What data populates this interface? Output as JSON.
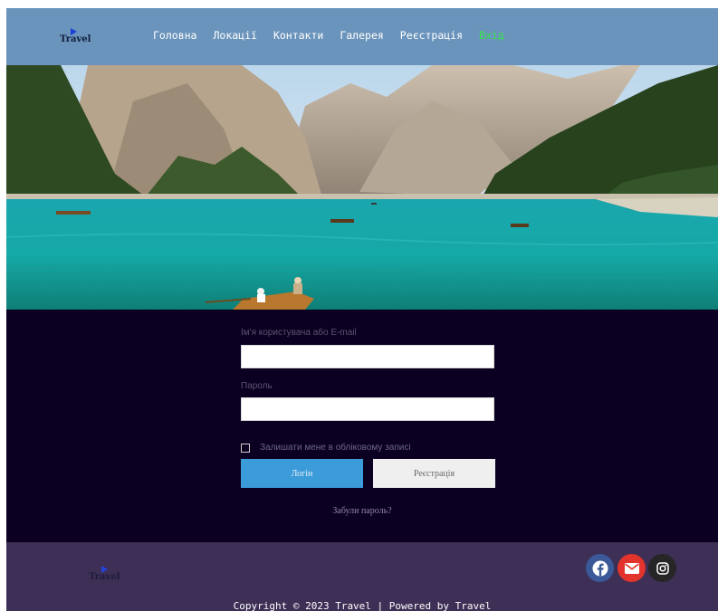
{
  "brand": {
    "logo_text": "Travel"
  },
  "nav": {
    "items": [
      {
        "label": "Головна"
      },
      {
        "label": "Локації"
      },
      {
        "label": "Контакти"
      },
      {
        "label": "Галерея"
      },
      {
        "label": "Реєстрація"
      },
      {
        "label": "Вхід",
        "active": true
      }
    ]
  },
  "login": {
    "username_label": "Ім'я користувача або E-mail",
    "username_value": "",
    "password_label": "Пароль",
    "password_value": "",
    "remember_label": "Залишати мене в обліковому записі",
    "remember_checked": false,
    "login_button": "Логін",
    "register_button": "Реєстрація",
    "forgot_link": "Забули пароль?"
  },
  "footer": {
    "logo_text": "Travel",
    "copyright": "Copyright © 2023 Travel | Powered by Travel",
    "social": [
      {
        "icon": "facebook-icon",
        "color": "#3b5998"
      },
      {
        "icon": "envelope-icon",
        "color": "#e2332c"
      },
      {
        "icon": "instagram-icon",
        "color": "#262626"
      }
    ]
  },
  "colors": {
    "header_bg": "#6b94bc",
    "nav_active": "#37e34a",
    "login_bg": "#0b0021",
    "login_button": "#3c9bd9",
    "footer_bg": "#3d2f55"
  }
}
